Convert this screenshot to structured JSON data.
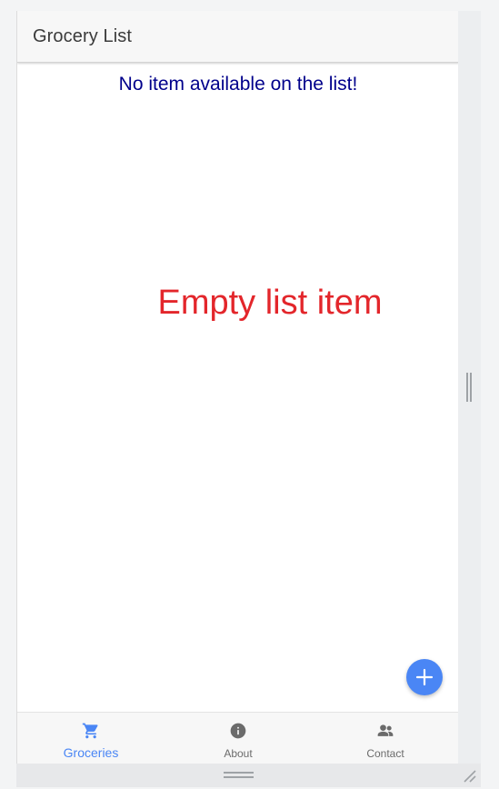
{
  "app": {
    "title": "Grocery List"
  },
  "main": {
    "empty_message": "No item available on the list!",
    "empty_image_text": "Empty list item"
  },
  "fab": {
    "icon": "plus-icon"
  },
  "bottom_nav": {
    "items": [
      {
        "label": "Groceries",
        "icon": "cart-icon",
        "active": true
      },
      {
        "label": "About",
        "icon": "info-icon",
        "active": false
      },
      {
        "label": "Contact",
        "icon": "contacts-icon",
        "active": false
      }
    ]
  },
  "colors": {
    "accent": "#4a86f5",
    "empty_message": "#00008b",
    "empty_image_text": "#e3262b"
  }
}
